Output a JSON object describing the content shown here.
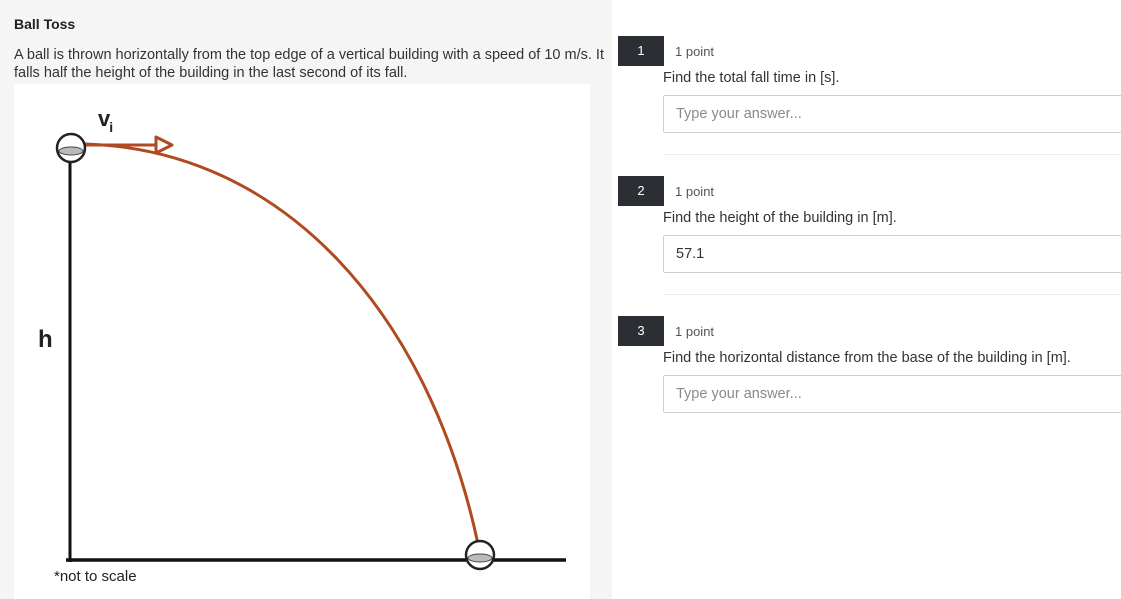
{
  "problem": {
    "title": "Ball Toss",
    "prompt": "A ball is thrown horizontally from the top edge of a vertical building with a speed of 10 m/s. It falls half the height of the building in the last second of its fall.",
    "figure": {
      "label_h": "h",
      "label_v": "v",
      "label_v_sub": "i",
      "note": "*not to scale",
      "colors": {
        "trajectory": "#b04a22",
        "lines": "#111111"
      }
    }
  },
  "questions": [
    {
      "number": "1",
      "points": "1 point",
      "text": "Find the total fall time in [s].",
      "value": "",
      "placeholder": "Type your answer..."
    },
    {
      "number": "2",
      "points": "1 point",
      "text": "Find the height of the building in [m].",
      "value": "57.1",
      "placeholder": "Type your answer..."
    },
    {
      "number": "3",
      "points": "1 point",
      "text": "Find the horizontal distance from the base of the building in [m].",
      "value": "",
      "placeholder": "Type your answer..."
    }
  ],
  "colors": {
    "number_badge_bg": "#2b2f33",
    "left_panel_bg": "#f5f5f5",
    "input_border": "#cfcfcf"
  }
}
